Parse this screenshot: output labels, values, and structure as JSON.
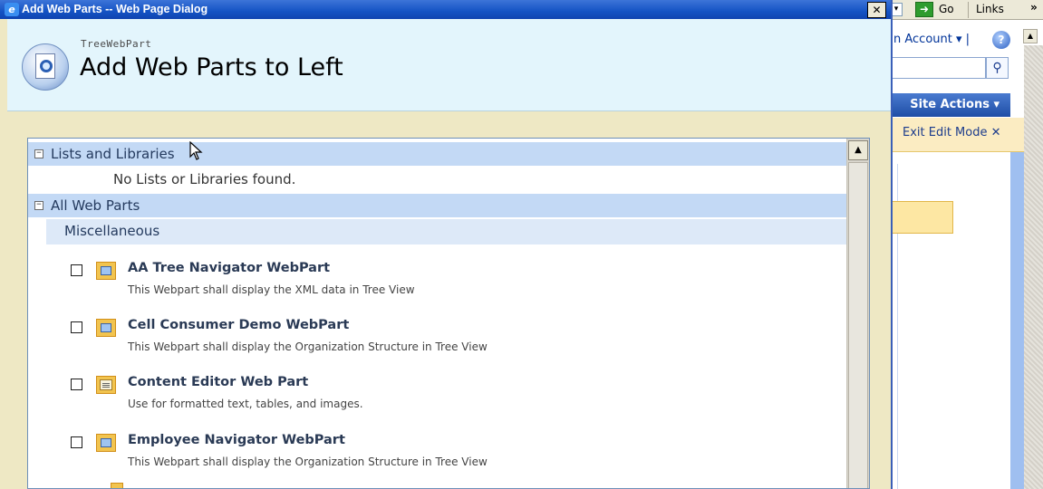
{
  "browser_toolbar": {
    "go_label": "Go",
    "links_label": "Links",
    "chevron": "»",
    "dropdown_glyph": "▾"
  },
  "background_page": {
    "account_label": "n Account ▾ |",
    "help_icon": "?",
    "search_placeholder": "",
    "site_actions_label": "Site Actions ▾",
    "exit_edit_mode_label": "Exit Edit Mode ✕",
    "scroll_up_glyph": "▲"
  },
  "dialog": {
    "title": "Add Web Parts -- Web Page Dialog",
    "ie_icon": "e",
    "close_glyph": "✕",
    "header": {
      "subtitle": "TreeWebPart",
      "title": "Add Web Parts to Left"
    }
  },
  "list": {
    "groups": [
      {
        "toggle": "−",
        "label": "Lists and Libraries"
      },
      {
        "toggle": "−",
        "label": "All Web Parts"
      }
    ],
    "no_items_text": "No Lists or Libraries found.",
    "category": "Miscellaneous",
    "web_parts": [
      {
        "title": "AA Tree Navigator WebPart",
        "description": "This Webpart shall display the XML data in Tree View",
        "checked": false,
        "icon": "webpart-icon"
      },
      {
        "title": "Cell Consumer Demo WebPart",
        "description": "This Webpart shall display the Organization Structure in Tree View",
        "checked": false,
        "icon": "webpart-icon"
      },
      {
        "title": "Content Editor Web Part",
        "description": "Use for formatted text, tables, and images.",
        "checked": false,
        "icon": "content-editor-icon"
      },
      {
        "title": "Employee Navigator WebPart",
        "description": "This Webpart shall display the Organization Structure in Tree View",
        "checked": false,
        "icon": "webpart-icon"
      }
    ],
    "scroll_up_glyph": "▲"
  },
  "colors": {
    "title_bar": "#1453c4",
    "header_background": "#e3f5fc",
    "group_header": "#c3d9f5",
    "dialog_frame": "#eee8c4"
  }
}
